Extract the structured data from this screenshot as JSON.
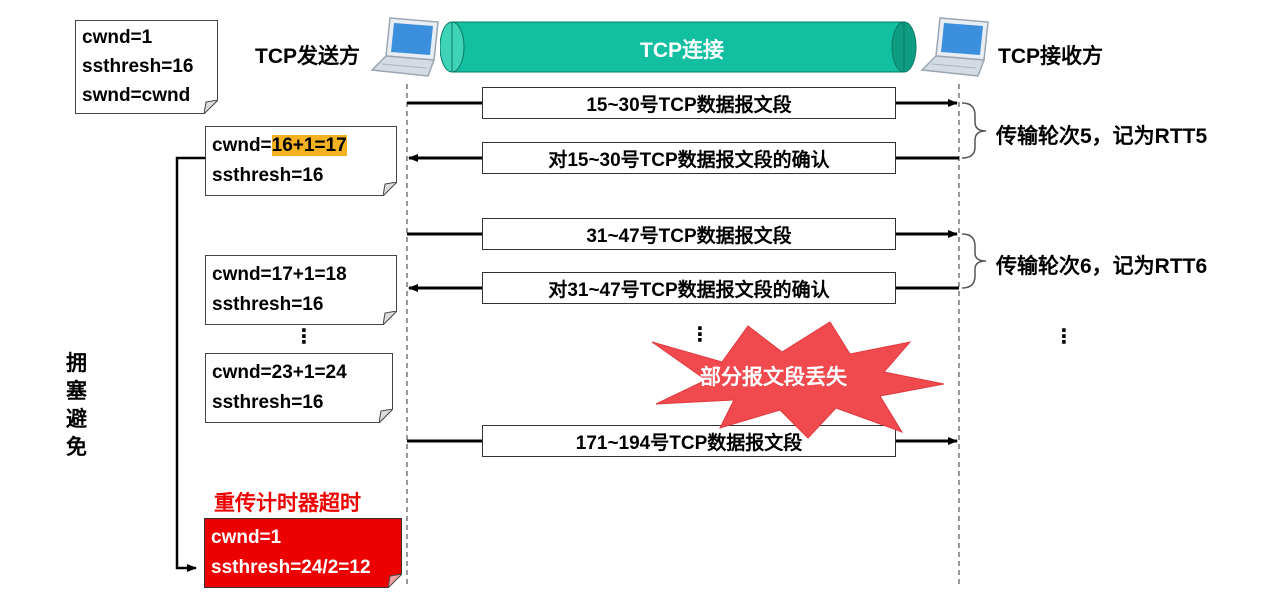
{
  "sender": {
    "label": "TCP发送方"
  },
  "receiver": {
    "label": "TCP接收方"
  },
  "connection": {
    "label": "TCP连接",
    "color": "#12bfa0"
  },
  "initial_state": {
    "line1": "cwnd=1",
    "line2": "ssthresh=16",
    "line3": "swnd=cwnd"
  },
  "state_rtt5": {
    "prefix": "cwnd=",
    "highlight": "16+1=17",
    "line2": "ssthresh=16",
    "highlight_color": "#f5b220"
  },
  "state_rtt6": {
    "line1": "cwnd=17+1=18",
    "line2": "ssthresh=16"
  },
  "state_later": {
    "line1": "cwnd=23+1=24",
    "line2": "ssthresh=16"
  },
  "state_timeout": {
    "line1": "cwnd=1",
    "line2": "ssthresh=24/2=12",
    "color": "#ee0000"
  },
  "timeout_label": "重传计时器超时",
  "phase_label": [
    "拥",
    "塞",
    "避",
    "免"
  ],
  "segments": {
    "s1": "15~30号TCP数据报文段",
    "a1": "对15~30号TCP数据报文段的确认",
    "s2": "31~47号TCP数据报文段",
    "a2": "对31~47号TCP数据报文段的确认",
    "s3": "171~194号TCP数据报文段"
  },
  "rounds": {
    "r5": "传输轮次5，记为RTT5",
    "r6": "传输轮次6，记为RTT6"
  },
  "loss_label": "部分报文段丢失",
  "loss_color": "#f04a4f",
  "ellipsis": "⋮"
}
